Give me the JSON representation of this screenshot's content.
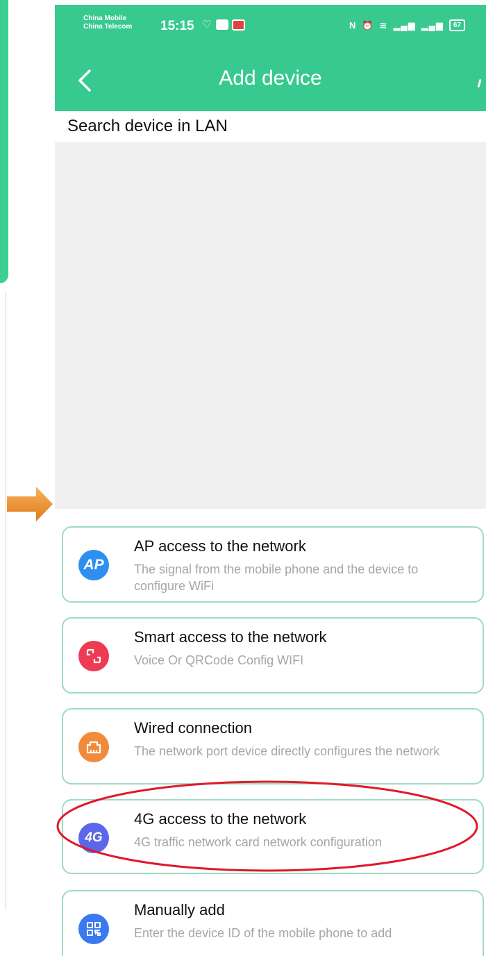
{
  "status_bar": {
    "carrier1": "China Mobile",
    "carrier2": "China Telecom",
    "time": "15:15",
    "battery": "67"
  },
  "header": {
    "title": "Add device"
  },
  "lan": {
    "label": "Search device in LAN"
  },
  "options": [
    {
      "title": "AP access to the network",
      "desc": "The signal from the mobile phone and the device to configure WiFi",
      "icon": "ap-icon",
      "color": "#2f8ff0",
      "glyph": "AP"
    },
    {
      "title": "Smart access to the network",
      "desc": "Voice Or QRCode Config WIFI",
      "icon": "smart-config-icon",
      "color": "#ee3a52",
      "glyph": ""
    },
    {
      "title": "Wired connection",
      "desc": "The network port device directly configures the network",
      "icon": "ethernet-port-icon",
      "color": "#f28a3c",
      "glyph": ""
    },
    {
      "title": "4G access to the network",
      "desc": "4G traffic network card network configuration",
      "icon": "4g-icon",
      "color": "#5a67e8",
      "glyph": "4G"
    },
    {
      "title": "Manually add",
      "desc": "Enter the device ID of the mobile phone to add",
      "icon": "qr-code-icon",
      "color": "#3b79f0",
      "glyph": ""
    }
  ],
  "annotations": {
    "arrow_color": "#f0922e",
    "ellipse_color": "#e0182a"
  }
}
